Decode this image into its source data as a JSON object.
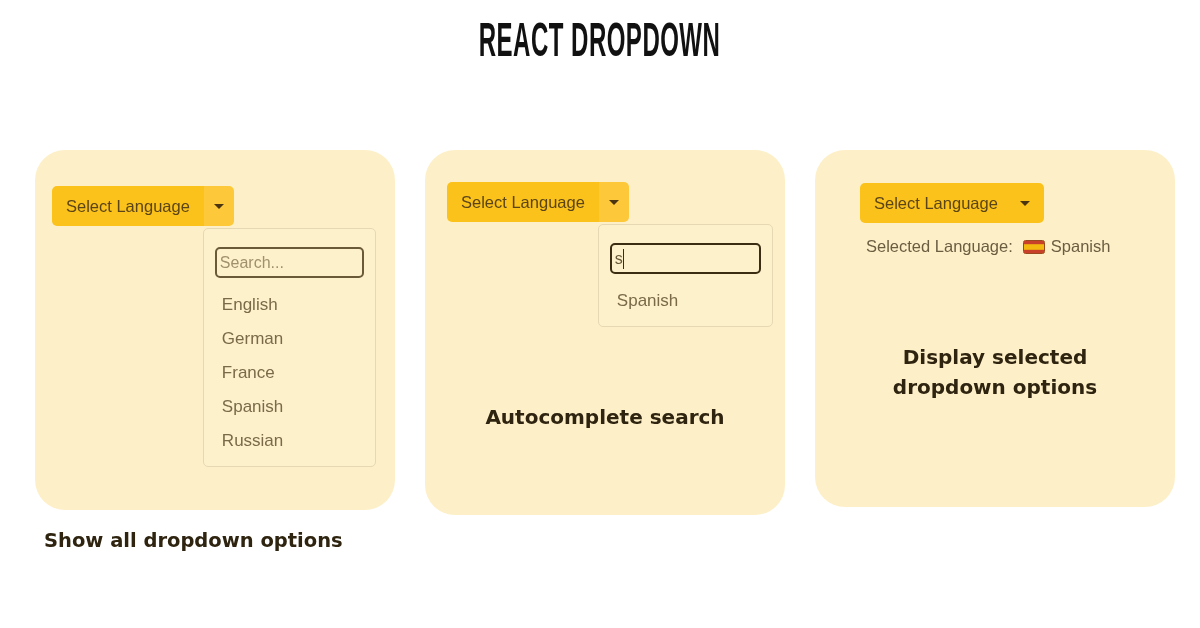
{
  "title": "REACT DROPDOWN",
  "panels": [
    {
      "dropdown": {
        "label": "Select Language",
        "split": true
      },
      "menu": {
        "search": {
          "placeholder": "Search...",
          "focused": false
        },
        "options": [
          "English",
          "German",
          "France",
          "Spanish",
          "Russian"
        ]
      },
      "caption": {
        "kind": "below",
        "text": "Show all dropdown options"
      }
    },
    {
      "dropdown": {
        "label": "Select Language",
        "split": true
      },
      "menu": {
        "search": {
          "value": "s",
          "focused": true
        },
        "options": [
          "Spanish"
        ]
      },
      "caption": {
        "kind": "inside",
        "text": "Autocomplete search"
      }
    },
    {
      "dropdown": {
        "label": "Select Language",
        "split": false
      },
      "selection": {
        "label": "Selected Language:",
        "value": "Spanish"
      },
      "caption": {
        "kind": "inside",
        "text": "Display selected dropdown options"
      }
    }
  ]
}
